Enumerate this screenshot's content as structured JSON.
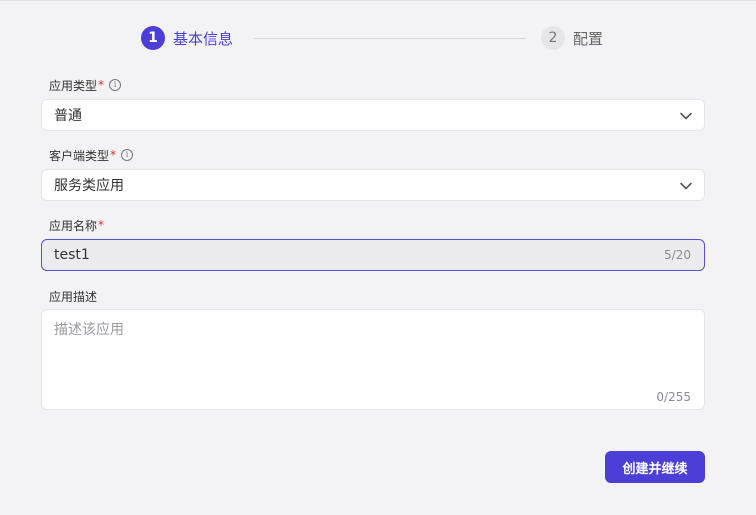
{
  "steps": [
    {
      "number": "1",
      "title": "基本信息",
      "active": true
    },
    {
      "number": "2",
      "title": "配置",
      "active": false
    }
  ],
  "form": {
    "app_type": {
      "label": "应用类型",
      "required_mark": "*",
      "value": "普通",
      "info_icon": "info-icon"
    },
    "client_type": {
      "label": "客户端类型",
      "required_mark": "*",
      "value": "服务类应用",
      "info_icon": "info-icon"
    },
    "app_name": {
      "label": "应用名称",
      "required_mark": "*",
      "value": "test1",
      "counter": "5/20"
    },
    "app_desc": {
      "label": "应用描述",
      "placeholder": "描述该应用",
      "value": "",
      "counter": "0/255"
    }
  },
  "actions": {
    "submit_label": "创建并继续"
  },
  "colors": {
    "accent": "#4b3fd8",
    "required": "#e0322b",
    "background": "#f3f3f5"
  }
}
